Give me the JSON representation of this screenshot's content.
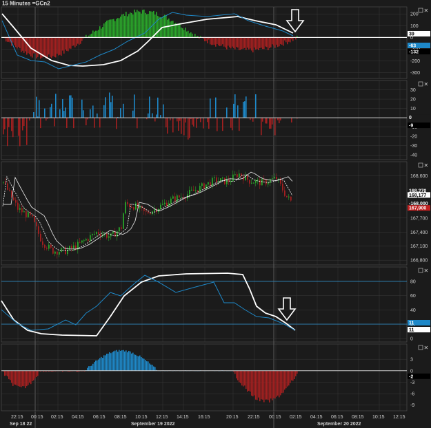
{
  "window": {
    "title": "15 Minutes =GCn2"
  },
  "colors": {
    "background": "#1b1b1b",
    "grid": "#3a3a3a",
    "pane_border": "#555555",
    "axis_text": "#cfcfcf",
    "up": "#2aa52a",
    "down": "#a32020",
    "blue": "#1e88c8",
    "white": "#ffffff",
    "hline": "#2f86b8"
  },
  "x_axis": {
    "time_labels": [
      "22:15",
      "00:15",
      "02:15",
      "04:15",
      "06:15",
      "08:15",
      "10:15",
      "12:15",
      "14:15",
      "16:15",
      "20:15",
      "22:15",
      "00:15",
      "02:15",
      "04:15",
      "06:15",
      "08:15",
      "10:15",
      "12:15"
    ],
    "date_labels": [
      "Sep 18 22",
      "September 19 2022",
      "September 20 2022"
    ]
  },
  "chart_data": [
    {
      "type": "bar",
      "panel": "oscillator-1",
      "ylim": [
        -350,
        260
      ],
      "ticks": [
        200,
        100,
        0,
        -100,
        -200,
        -300
      ],
      "tick_labels": [
        "200",
        "100",
        "0",
        "-100",
        "-200",
        "-300"
      ],
      "value_badges": [
        "39",
        "-63",
        "-132"
      ],
      "note": "histogram plus two smoothing lines (white and blue)"
    },
    {
      "type": "bar",
      "panel": "oscillator-2",
      "ylim": [
        -45,
        40
      ],
      "ticks": [
        30,
        20,
        10,
        0,
        -10,
        -20,
        -30,
        -40
      ],
      "tick_labels": [
        "30",
        "20",
        "10",
        "0",
        "-10",
        "-20",
        "-30",
        "-40"
      ],
      "value_badges": [
        "0",
        "-9"
      ]
    },
    {
      "type": "candlestick",
      "panel": "price",
      "ylim": [
        166700,
        168900
      ],
      "ticks": [
        168600,
        168000,
        167700,
        167400,
        167100,
        166800
      ],
      "tick_labels": [
        "168,600",
        "168,000",
        "167,700",
        "167,400",
        "167,100",
        "166,800"
      ],
      "value_badges": [
        "168,270",
        "168,177",
        "-168,000",
        "167,900"
      ]
    },
    {
      "type": "line",
      "panel": "stochastic",
      "ylim": [
        -5,
        100
      ],
      "ticks": [
        80,
        60,
        40,
        20,
        0
      ],
      "tick_labels": [
        "80",
        "60",
        "40",
        "20",
        "0"
      ],
      "levels": [
        80,
        20
      ],
      "value_badges": [
        "11",
        "11"
      ]
    },
    {
      "type": "bar",
      "panel": "histogram",
      "ylim": [
        -10.5,
        7
      ],
      "ticks": [
        3,
        0,
        -3,
        -6,
        -9
      ],
      "tick_labels": [
        "3",
        "0",
        "-3",
        "-6",
        "-9"
      ],
      "value_badges": [
        "-2"
      ]
    }
  ]
}
